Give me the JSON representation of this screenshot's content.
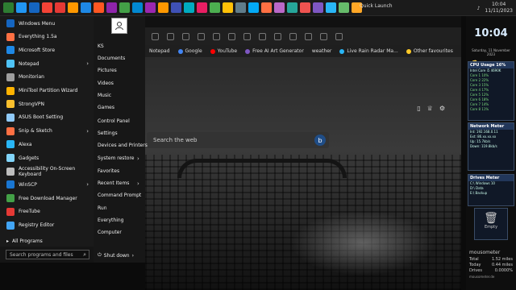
{
  "taskbar": {
    "quick_launch": "Quick Launch",
    "time": "10:04",
    "date": "11/11/2023",
    "icon_colors": [
      "#2e7d32",
      "#2196f3",
      "#1565c0",
      "#f44336",
      "#e53935",
      "#ff9800",
      "#1e88e5",
      "#ff5722",
      "#8e24aa",
      "#43a047",
      "#0288d1",
      "#9c27b0",
      "#ff9800",
      "#3f51b5",
      "#00acc1",
      "#e91e63",
      "#4caf50",
      "#ffc107",
      "#607d8b",
      "#03a9f4",
      "#ff7043",
      "#ba68c8",
      "#26a69a",
      "#ef5350",
      "#7e57c2",
      "#29b6f6",
      "#66bb6a",
      "#ffa726"
    ]
  },
  "start_menu": {
    "items": [
      {
        "label": "Windows Menu",
        "color": "#1565c0",
        "arrow": false
      },
      {
        "label": "Everything 1.5a",
        "color": "#ff7043",
        "arrow": false
      },
      {
        "label": "Microsoft Store",
        "color": "#1e88e5",
        "arrow": false
      },
      {
        "label": "Notepad",
        "color": "#4fc3f7",
        "arrow": true
      },
      {
        "label": "Monitorian",
        "color": "#9e9e9e",
        "arrow": false
      },
      {
        "label": "MiniTool Partition Wizard",
        "color": "#ffb300",
        "arrow": false
      },
      {
        "label": "StrongVPN",
        "color": "#fbc02d",
        "arrow": false
      },
      {
        "label": "ASUS Boot Setting",
        "color": "#90caf9",
        "arrow": false
      },
      {
        "label": "Snip & Sketch",
        "color": "#ff7043",
        "arrow": true
      },
      {
        "label": "Alexa",
        "color": "#29b6f6",
        "arrow": false
      },
      {
        "label": "Gadgets",
        "color": "#81d4fa",
        "arrow": false
      },
      {
        "label": "Accessibility On-Screen Keyboard",
        "color": "#bdbdbd",
        "arrow": false
      },
      {
        "label": "WinSCP",
        "color": "#1976d2",
        "arrow": true
      },
      {
        "label": "Free Download Manager",
        "color": "#43a047",
        "arrow": false
      },
      {
        "label": "FreeTube",
        "color": "#e53935",
        "arrow": false
      },
      {
        "label": "Registry Editor",
        "color": "#42a5f5",
        "arrow": false
      }
    ],
    "all_programs": "All Programs",
    "search_placeholder": "Search programs and files",
    "right_pane": {
      "items": [
        {
          "label": "KS",
          "arrow": false
        },
        {
          "label": "Documents",
          "arrow": false
        },
        {
          "label": "Pictures",
          "arrow": false
        },
        {
          "label": "Videos",
          "arrow": false
        },
        {
          "label": "Music",
          "arrow": false
        },
        {
          "label": "Games",
          "arrow": false
        },
        {
          "label": "Control Panel",
          "arrow": false
        },
        {
          "label": "Settings",
          "arrow": false
        },
        {
          "label": "Devices and Printers",
          "arrow": false
        },
        {
          "label": "System restore",
          "arrow": true
        },
        {
          "label": "Favorites",
          "arrow": false
        },
        {
          "label": "Recent Items",
          "arrow": true
        },
        {
          "label": "Command Prompt",
          "arrow": false
        },
        {
          "label": "Run",
          "arrow": false
        },
        {
          "label": "Everything",
          "arrow": false
        },
        {
          "label": "Computer",
          "arrow": false
        }
      ],
      "shutdown": "Shut down"
    }
  },
  "browser": {
    "favorites": [
      {
        "label": "Notepad",
        "color": ""
      },
      {
        "label": "Google",
        "color": "#4285f4"
      },
      {
        "label": "YouTube",
        "color": "#ff0000"
      },
      {
        "label": "Free AI Art Generator",
        "color": "#7e57c2"
      },
      {
        "label": "weather",
        "color": ""
      },
      {
        "label": "Live Rain Radar Ma...",
        "color": "#29b6f6"
      },
      {
        "label": "Other favourites",
        "color": "#ffca28"
      }
    ],
    "search_placeholder": "Search the web"
  },
  "gadgets": {
    "clock": "10:04",
    "date": "Saturday, 11 November 2023",
    "cpu": {
      "title": "CPU Usage 16%",
      "lines": [
        "Intel Core i5 4690K",
        "Core 1   10%",
        "Core 2   22%",
        "Core 3   15%",
        "Core 4   17%",
        "Core 5   12%",
        "Core 6   18%",
        "Core 7   14%",
        "Core 8   11%"
      ]
    },
    "network": {
      "title": "Network Meter",
      "lines": [
        "Int: 192.168.0.11",
        "Ext: 86.xx.xx.xx",
        "Up: 15.7kb/s",
        "Down: 119.8kb/s"
      ]
    },
    "drives": {
      "title": "Drives Meter",
      "lines": [
        "C:\\ Windows 10",
        "D:\\ Data",
        "E:\\ Backup"
      ]
    },
    "recycle": "Empty",
    "mouse": {
      "title": "mousometer",
      "rows": [
        [
          "Total",
          "1.52 miles"
        ],
        [
          "Today",
          "0.44 miles"
        ],
        [
          "Drives",
          "0.0000%"
        ]
      ],
      "footer": "mousometer.de"
    }
  }
}
